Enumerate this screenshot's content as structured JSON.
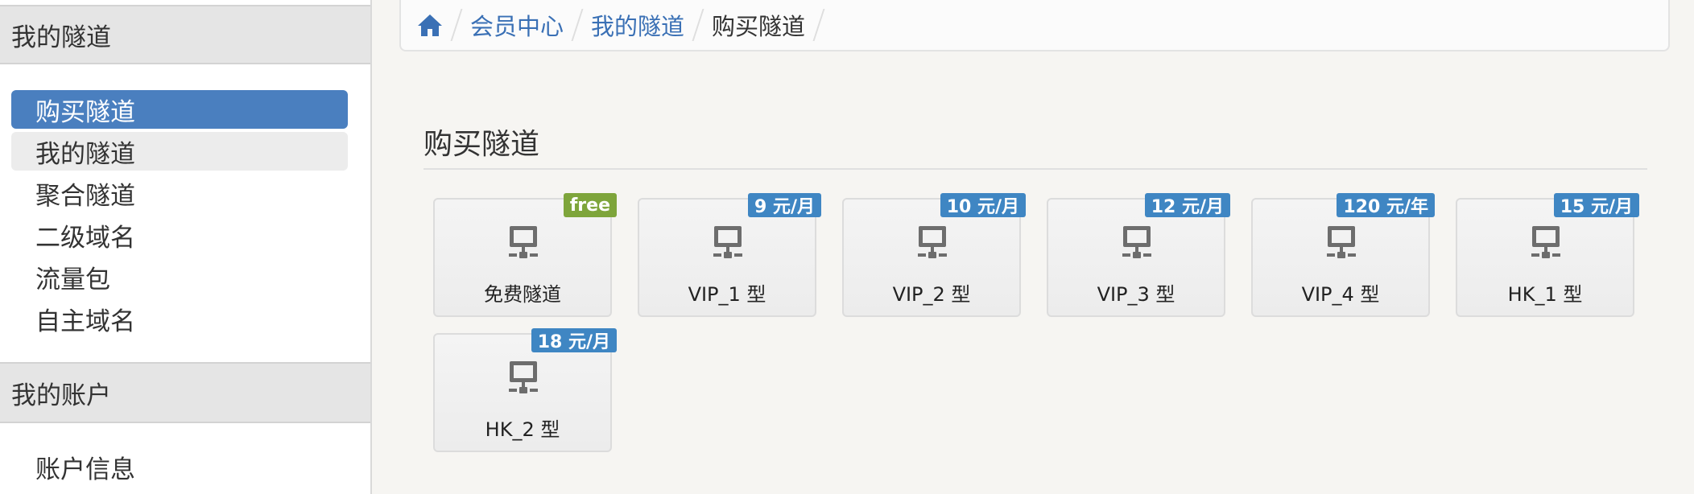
{
  "sidebar": {
    "section1_title": "我的隧道",
    "items": [
      {
        "label": "购买隧道"
      },
      {
        "label": "我的隧道"
      },
      {
        "label": "聚合隧道"
      },
      {
        "label": "二级域名"
      },
      {
        "label": "流量包"
      },
      {
        "label": "自主域名"
      }
    ],
    "section2_title": "我的账户",
    "items2": [
      {
        "label": "账户信息"
      }
    ]
  },
  "breadcrumb": {
    "home_icon": "home-icon",
    "items": [
      "会员中心",
      "我的隧道",
      "购买隧道"
    ]
  },
  "main": {
    "title": "购买隧道",
    "cards": [
      {
        "name": "免费隧道",
        "badge": "free",
        "badge_color": "#7ea53b",
        "icon": "monitor-network-icon"
      },
      {
        "name": "VIP_1 型",
        "badge": "9 元/月",
        "badge_color": "#3f86c3",
        "icon": "monitor-network-icon"
      },
      {
        "name": "VIP_2 型",
        "badge": "10 元/月",
        "badge_color": "#3f86c3",
        "icon": "monitor-network-icon"
      },
      {
        "name": "VIP_3 型",
        "badge": "12 元/月",
        "badge_color": "#3f86c3",
        "icon": "monitor-network-icon"
      },
      {
        "name": "VIP_4 型",
        "badge": "120 元/年",
        "badge_color": "#3f86c3",
        "icon": "monitor-network-icon"
      },
      {
        "name": "HK_1 型",
        "badge": "15 元/月",
        "badge_color": "#3f86c3",
        "icon": "monitor-network-icon"
      },
      {
        "name": "HK_2 型",
        "badge": "18 元/月",
        "badge_color": "#3f86c3",
        "icon": "monitor-network-icon"
      }
    ]
  },
  "colors": {
    "accent": "#4a7fbf",
    "link": "#3a70b5",
    "badge_blue": "#3f86c3",
    "badge_green": "#7ea53b"
  }
}
